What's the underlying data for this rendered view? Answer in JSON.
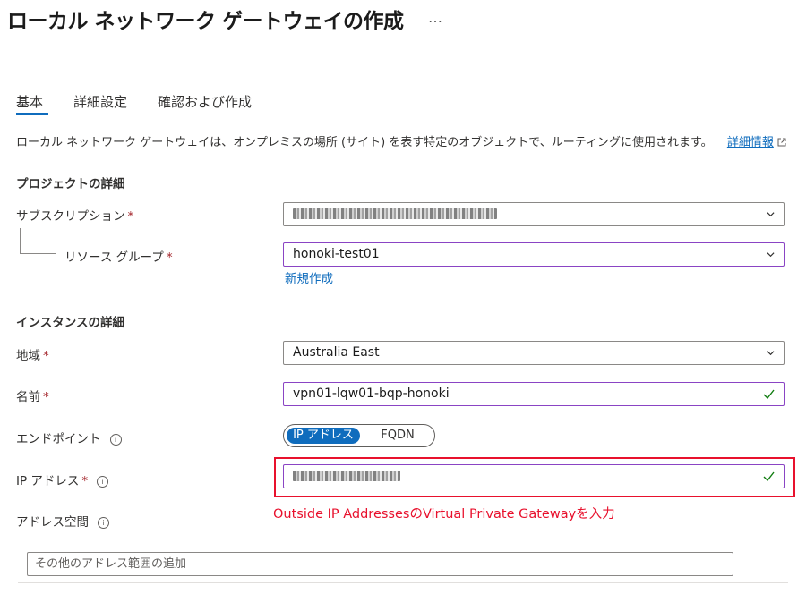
{
  "page": {
    "title": "ローカル ネットワーク ゲートウェイの作成",
    "more": "…"
  },
  "tabs": [
    {
      "label": "基本",
      "active": true
    },
    {
      "label": "詳細設定",
      "active": false
    },
    {
      "label": "確認および作成",
      "active": false
    }
  ],
  "description": {
    "text": "ローカル ネットワーク ゲートウェイは、オンプレミスの場所 (サイト) を表す特定のオブジェクトで、ルーティングに使用されます。",
    "link": "詳細情報"
  },
  "project": {
    "heading": "プロジェクトの詳細",
    "subscription_label": "サブスクリプション",
    "resource_group_label": "リソース グループ",
    "resource_group_value": "honoki-test01",
    "new_link": "新規作成"
  },
  "instance": {
    "heading": "インスタンスの詳細",
    "region_label": "地域",
    "region_value": "Australia East",
    "name_label": "名前",
    "name_value": "vpn01-lqw01-bqp-honoki",
    "endpoint_label": "エンドポイント",
    "endpoint_options": [
      "IP アドレス",
      "FQDN"
    ],
    "endpoint_selected": "IP アドレス",
    "ip_label": "IP アドレス",
    "address_space_label": "アドレス空間",
    "address_placeholder": "その他のアドレス範囲の追加"
  },
  "required_mark": "*",
  "annotation": "Outside IP AddressesのVirtual Private Gatewayを入力",
  "colors": {
    "accent": "#0f6cbd",
    "required": "#a4262c",
    "valid_check": "#107c10",
    "annotation_red": "#e8112d",
    "focus_border": "#8a44c4"
  }
}
